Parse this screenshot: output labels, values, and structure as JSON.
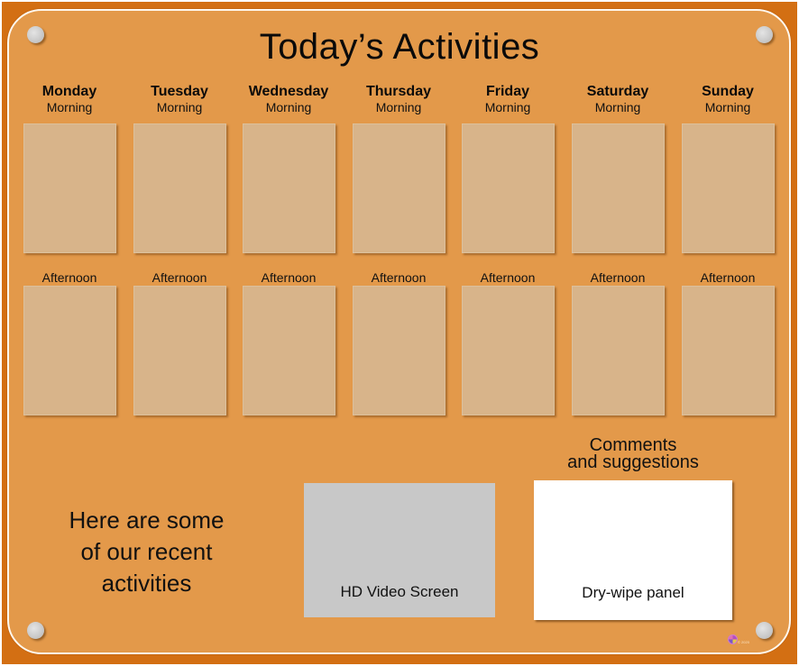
{
  "board": {
    "title": "Today’s Activities",
    "colors": {
      "frame": "#d36f13",
      "board": "#e3994a",
      "slot": "#d8b48a",
      "video_screen": "#c8c8c8",
      "dry_wipe": "#ffffff"
    }
  },
  "schedule": {
    "morning_label": "Morning",
    "afternoon_label": "Afternoon",
    "days": [
      {
        "name": "Monday"
      },
      {
        "name": "Tuesday"
      },
      {
        "name": "Wednesday"
      },
      {
        "name": "Thursday"
      },
      {
        "name": "Friday"
      },
      {
        "name": "Saturday"
      },
      {
        "name": "Sunday"
      }
    ]
  },
  "recent": {
    "line1": "Here are some",
    "line2": "of our recent",
    "line3": "activities"
  },
  "video": {
    "label": "HD Video Screen"
  },
  "comments": {
    "heading_line1": "Comments",
    "heading_line2": "and suggestions",
    "panel_label": "Dry-wipe panel"
  },
  "footer": {
    "copyright": "© 2020",
    "logo_icon": "multicolor-circle-logo"
  }
}
